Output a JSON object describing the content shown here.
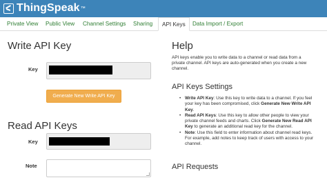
{
  "brand": {
    "name": "ThingSpeak",
    "tm": "™"
  },
  "tabs": [
    {
      "label": "Private View",
      "active": false
    },
    {
      "label": "Public View",
      "active": false
    },
    {
      "label": "Channel Settings",
      "active": false
    },
    {
      "label": "Sharing",
      "active": false
    },
    {
      "label": "API Keys",
      "active": true
    },
    {
      "label": "Data Import / Export",
      "active": false
    }
  ],
  "write": {
    "heading": "Write API Key",
    "key_label": "Key",
    "generate_button": "Generate New Write API Key"
  },
  "read": {
    "heading": "Read API Keys",
    "key_label": "Key",
    "note_label": "Note"
  },
  "help": {
    "heading": "Help",
    "intro": "API keys enable you to write data to a channel or read data from a private channel. API keys are auto-generated when you create a new channel.",
    "settings_heading": "API Keys Settings",
    "bullets": [
      {
        "term": "Write API Key",
        "text": ": Use this key to write data to a channel. If you feel your key has been compromised, click ",
        "action": "Generate New Write API Key",
        "tail": "."
      },
      {
        "term": "Read API Keys",
        "text": ": Use this key to allow other people to view your private channel feeds and charts. Click ",
        "action": "Generate New Read API Key",
        "tail": " to generate an additional read key for the channel."
      },
      {
        "term": "Note",
        "text": ": Use this field to enter information about channel read keys. For example, add notes to keep track of users with access to your channel.",
        "action": "",
        "tail": ""
      }
    ],
    "requests_heading": "API Requests"
  },
  "colors": {
    "topbar": "#3d84b9",
    "tab_link": "#2e7d32",
    "button": "#f0ad4e"
  }
}
